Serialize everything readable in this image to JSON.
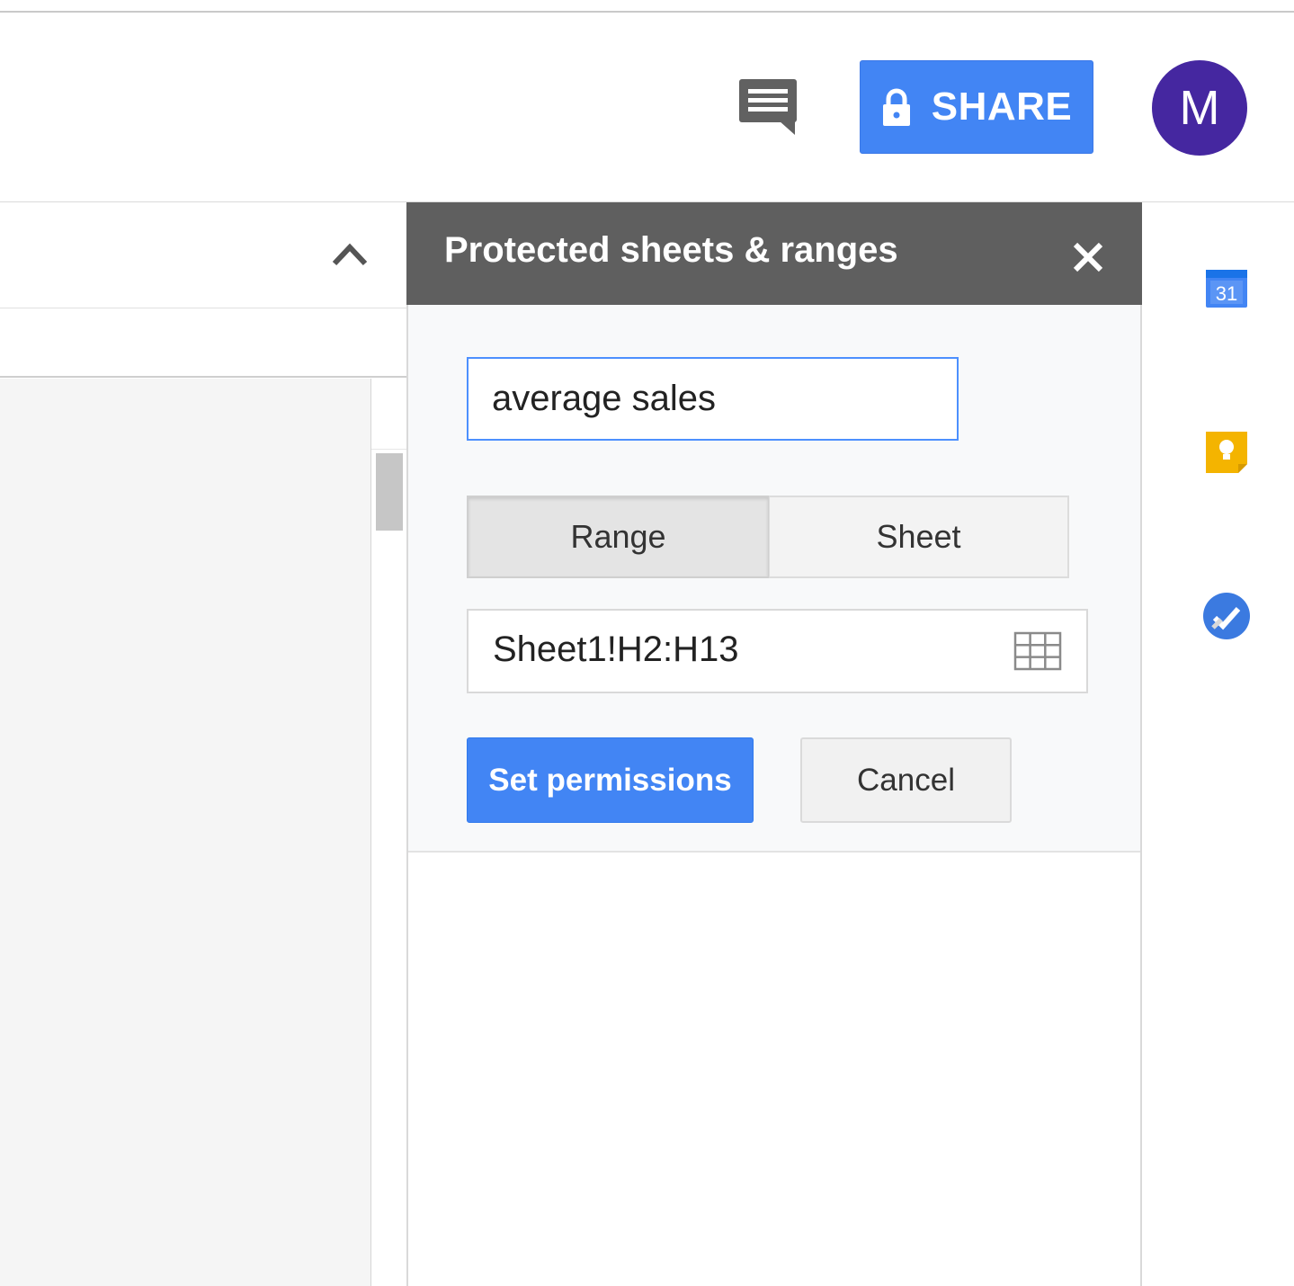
{
  "header": {
    "share_label": "SHARE",
    "avatar_initial": "M",
    "accent_color": "#4285f4",
    "avatar_color": "#4527a0",
    "comments_icon": "comments-icon",
    "lock_icon": "lock-icon"
  },
  "panel": {
    "title": "Protected sheets & ranges",
    "close_icon": "close-icon",
    "description_value": "average sales",
    "toggle": {
      "range_label": "Range",
      "sheet_label": "Sheet",
      "selected": "Range"
    },
    "range_value": "Sheet1!H2:H13",
    "grid_icon": "grid-select-icon",
    "set_permissions_label": "Set permissions",
    "cancel_label": "Cancel"
  },
  "rail": {
    "calendar_day": "31",
    "icons": [
      "calendar-icon",
      "keep-icon",
      "tasks-icon"
    ]
  }
}
